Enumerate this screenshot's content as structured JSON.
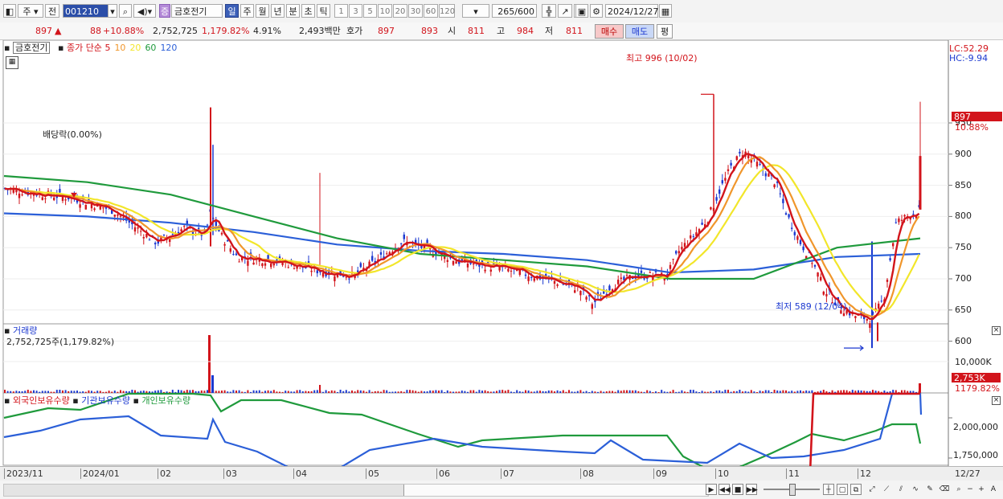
{
  "toolbar": {
    "market": "주",
    "mode": "전",
    "code": "001210",
    "stock_name": "금호전기",
    "stock_badge": "증",
    "period_tabs": [
      "일",
      "주",
      "월",
      "년",
      "분",
      "초",
      "틱"
    ],
    "active_period": "일",
    "intervals": [
      "1",
      "3",
      "5",
      "10",
      "20",
      "30",
      "60",
      "120"
    ],
    "count": "265",
    "count_max": "/600",
    "date": "2024/12/27"
  },
  "quote": {
    "price": "897",
    "arrow": "▲",
    "change": "88",
    "change_pct": "+10.88%",
    "volume": "2,752,725",
    "volume_pct": "1,179.82%",
    "turnover": "4.91%",
    "amount": "2,493백만",
    "ask_label": "호가",
    "ask": "897",
    "bid": "893",
    "open_label": "시",
    "open": "811",
    "high_label": "고",
    "high": "984",
    "low_label": "저",
    "low": "811",
    "buy_button": "매수",
    "sell_button": "매도",
    "eval_button": "평"
  },
  "price_pane": {
    "stock_label": "금호전기",
    "ma_label": "종가 단순",
    "ma_periods": [
      "5",
      "10",
      "20",
      "60",
      "120"
    ],
    "ma_colors": [
      "#d2141b",
      "#f0962b",
      "#f2e62a",
      "#1f9a3c",
      "#2b5fd8"
    ],
    "lc_label": "LC:52.29",
    "hc_label": "HC:-9.94",
    "high_marker": "최고 996 (10/02)",
    "low_marker": "최저 589 (12/04)",
    "dividend_marker": "배당락(0.00%)",
    "current_price_tag": "897",
    "current_change_tag": "10.88%",
    "y_ticks": [
      "950",
      "900",
      "850",
      "800",
      "750",
      "700",
      "650",
      "600"
    ]
  },
  "volume_pane": {
    "title": "거래량",
    "value": "2,752,725주(1,179.82%)",
    "y_tick": "10,000K",
    "current_tag": "2,753K",
    "current_pct": "1179.82%"
  },
  "holdings_pane": {
    "series": [
      "외국인보유수량",
      "기관보유수량",
      "개인보유수량"
    ],
    "colors": [
      "#d2141b",
      "#2b5fd8",
      "#1f9a3c"
    ],
    "y_ticks": [
      "2,000,000",
      "1,750,000"
    ]
  },
  "x_axis": {
    "ticks": [
      "2023/11",
      "2024/01",
      "02",
      "03",
      "04",
      "05",
      "06",
      "07",
      "08",
      "09",
      "10",
      "11",
      "12"
    ],
    "end_label": "12/27"
  },
  "chart_data": {
    "type": "candlestick",
    "ylim": [
      560,
      1000
    ],
    "candles_range": [
      "2023/11",
      "2024/12/27"
    ],
    "ma120": [
      805,
      800,
      790,
      775,
      755,
      745,
      740,
      730,
      710,
      715,
      735,
      740
    ],
    "ma60": [
      865,
      855,
      835,
      800,
      765,
      740,
      730,
      720,
      700,
      700,
      750,
      765
    ]
  }
}
